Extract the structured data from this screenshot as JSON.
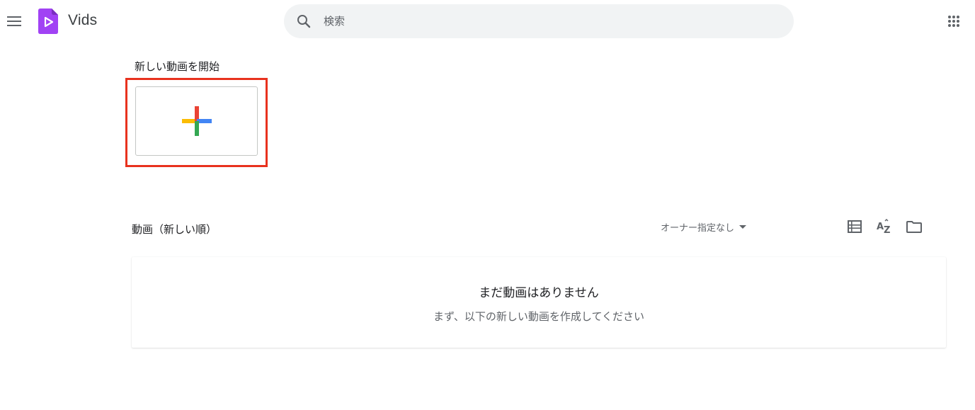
{
  "header": {
    "app_name": "Vids",
    "search_placeholder": "検索",
    "menu_icon": "hamburger-menu-icon",
    "apps_icon": "apps-grid-icon"
  },
  "start_section": {
    "title": "新しい動画を開始",
    "new_video_icon": "plus-icon"
  },
  "list_section": {
    "title": "動画（新しい順）",
    "owner_filter_label": "オーナー指定なし",
    "tools": [
      "list-view-icon",
      "sort-az-icon",
      "folder-icon"
    ]
  },
  "empty_state": {
    "title": "まだ動画はありません",
    "subtitle": "まず、以下の新しい動画を作成してください"
  },
  "colors": {
    "brand_purple": "#a142f4",
    "highlight_red": "#e8321e",
    "plus_red": "#ea4335",
    "plus_blue": "#4285f4",
    "plus_yellow": "#fbbc04",
    "plus_green": "#34a853"
  }
}
